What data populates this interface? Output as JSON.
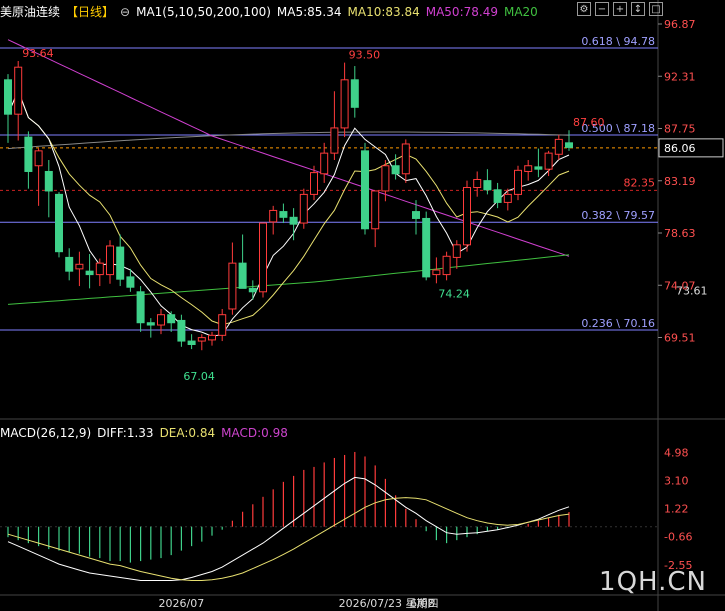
{
  "header": {
    "instrument": "美原油连续",
    "period": "【日线】",
    "ma_title": "MA1(5,10,50,200,100)",
    "ma5": "MA5:85.34",
    "ma10": "MA10:83.84",
    "ma50": "MA50:78.49",
    "ma20": "MA20",
    "icons": [
      "settings-icon",
      "minus-icon",
      "plus-icon",
      "tool-icon",
      "maximize-icon"
    ]
  },
  "macd_header": {
    "title": "MACD(26,12,9)",
    "diff": "DIFF:1.33",
    "dea": "DEA:0.84",
    "macd": "MACD:0.98"
  },
  "colors": {
    "up": "#ff3b3b",
    "down": "#3fd18a",
    "ma5": "#ffffff",
    "ma10": "#e8e070",
    "ma50": "#d040d0",
    "ma20": "#40c040",
    "ma200": "#888888",
    "fib": "#8080ff",
    "last": "#ff9900",
    "macd_label": "#cc44cc"
  },
  "chart_data": {
    "type": "candlestick",
    "title": "美原油连续",
    "price_ylim": [
      66.5,
      96.87
    ],
    "price_ticks": [
      "96.87",
      "92.31",
      "87.75",
      "83.19",
      "78.63",
      "74.07",
      "69.51"
    ],
    "current_price": "86.06",
    "secondary_price": "73.61",
    "fib_levels": [
      {
        "label": "0.618 \\ 94.78",
        "value": 94.78
      },
      {
        "label": "0.500 \\ 87.18",
        "value": 87.18
      },
      {
        "label": "0.382 \\ 79.57",
        "value": 79.57
      },
      {
        "label": "0.236 \\ 70.16",
        "value": 70.16
      }
    ],
    "red_level": {
      "label": "82.35",
      "value": 82.35
    },
    "annotations": [
      {
        "text": "93.64",
        "index": 1,
        "value": 93.64,
        "color": "red"
      },
      {
        "text": "93.50",
        "index": 33,
        "value": 93.5,
        "color": "red"
      },
      {
        "text": "67.04",
        "index": 17,
        "value": 67.04,
        "color": "green"
      },
      {
        "text": "74.24",
        "index": 42,
        "value": 74.24,
        "color": "green"
      },
      {
        "text": "87.60",
        "index": 55,
        "value": 87.6,
        "color": "red"
      }
    ],
    "candles": [
      [
        92,
        92.5,
        86.5,
        89
      ],
      [
        89,
        93.64,
        86.7,
        93.1
      ],
      [
        87,
        87.5,
        82.5,
        84
      ],
      [
        84.5,
        86,
        81,
        85.8
      ],
      [
        84,
        85,
        80,
        82.3
      ],
      [
        82,
        82.2,
        76.5,
        77
      ],
      [
        76.5,
        77.3,
        74.5,
        75.3
      ],
      [
        75.5,
        77,
        74,
        75.9
      ],
      [
        75.3,
        76.8,
        73.8,
        75
      ],
      [
        75,
        76.4,
        74,
        76
      ],
      [
        75,
        78,
        74.2,
        77.5
      ],
      [
        77.4,
        78.5,
        74,
        74.6
      ],
      [
        74.8,
        75.5,
        73.5,
        73.9
      ],
      [
        73.5,
        74,
        70,
        70.8
      ],
      [
        70.8,
        71.2,
        69.5,
        70.6
      ],
      [
        70.6,
        72,
        69.8,
        71.5
      ],
      [
        71.5,
        71.8,
        70,
        70.8
      ],
      [
        71,
        71.5,
        68.7,
        69.2
      ],
      [
        69.2,
        69.8,
        68.5,
        68.9
      ],
      [
        69.2,
        69.8,
        68.4,
        69.5
      ],
      [
        69.3,
        70,
        68.8,
        69.7
      ],
      [
        69.7,
        72,
        69.2,
        71.5
      ],
      [
        72,
        77.8,
        71.5,
        76
      ],
      [
        76,
        78.5,
        75,
        73.8
      ],
      [
        73.8,
        74.5,
        72.8,
        73.5
      ],
      [
        73.5,
        78,
        73,
        79.5
      ],
      [
        79.6,
        81,
        78.5,
        80.6
      ],
      [
        80.5,
        81.2,
        79.5,
        80
      ],
      [
        80,
        80.8,
        78,
        79.4
      ],
      [
        79.5,
        82.5,
        79,
        82
      ],
      [
        82,
        84.5,
        81.5,
        83.9
      ],
      [
        83.8,
        86.5,
        83,
        85.6
      ],
      [
        85.6,
        91,
        85,
        87.8
      ],
      [
        87.8,
        93.5,
        87,
        92
      ],
      [
        92,
        93.2,
        88.7,
        89.6
      ],
      [
        85.8,
        86.5,
        78.5,
        79
      ],
      [
        79,
        82,
        77.4,
        82.3
      ],
      [
        82.3,
        85,
        81.4,
        84.5
      ],
      [
        84.5,
        85.5,
        83.3,
        83.8
      ],
      [
        83.8,
        86.8,
        83,
        86.4
      ],
      [
        80.5,
        81.5,
        78.5,
        79.9
      ],
      [
        79.9,
        80.5,
        74.5,
        74.8
      ],
      [
        75,
        76.5,
        74.24,
        75.4
      ],
      [
        75,
        77,
        74.5,
        76.6
      ],
      [
        76.5,
        78,
        75.5,
        77.6
      ],
      [
        77.6,
        83.2,
        77,
        82.6
      ],
      [
        82.6,
        84,
        81.8,
        83.3
      ],
      [
        83.2,
        84.2,
        82,
        82.4
      ],
      [
        82.4,
        83,
        80.8,
        81.3
      ],
      [
        81.3,
        82.5,
        80.6,
        82
      ],
      [
        82,
        84.5,
        81.5,
        84.1
      ],
      [
        84,
        85,
        83.2,
        84.5
      ],
      [
        84.4,
        86,
        83.5,
        84.2
      ],
      [
        84.2,
        85.8,
        83.6,
        85.6
      ],
      [
        85.5,
        87.2,
        85,
        86.8
      ],
      [
        86.5,
        87.6,
        85.8,
        86.1
      ]
    ],
    "macd_ylim": [
      -3.9,
      5.6
    ],
    "macd_ticks": [
      "4.98",
      "3.10",
      "1.22",
      "-0.66",
      "-2.55"
    ],
    "macd_hist": [
      -0.7,
      -0.9,
      -1.1,
      -1.3,
      -1.5,
      -1.6,
      -1.7,
      -1.8,
      -2,
      -2.1,
      -2.3,
      -2.3,
      -2.4,
      -2.3,
      -2.2,
      -2.1,
      -1.9,
      -1.6,
      -1.3,
      -1,
      -0.6,
      -0.2,
      0.4,
      1,
      1.5,
      2,
      2.5,
      3,
      3.4,
      3.8,
      4,
      4.3,
      4.6,
      4.8,
      5,
      4.7,
      4.1,
      3.2,
      2.1,
      1.2,
      0.5,
      -0.3,
      -0.9,
      -1.1,
      -0.9,
      -0.7,
      -0.5,
      -0.3,
      -0.2,
      -0.1,
      0,
      0.2,
      0.4,
      0.6,
      0.8,
      0.98
    ],
    "macd_diff": [
      -1,
      -1.3,
      -1.6,
      -1.9,
      -2.2,
      -2.5,
      -2.7,
      -2.9,
      -3.1,
      -3.2,
      -3.3,
      -3.4,
      -3.5,
      -3.6,
      -3.6,
      -3.6,
      -3.6,
      -3.55,
      -3.4,
      -3.2,
      -3,
      -2.7,
      -2.3,
      -1.9,
      -1.5,
      -1.1,
      -0.6,
      -0.1,
      0.4,
      0.9,
      1.4,
      1.9,
      2.4,
      2.9,
      3.3,
      3.2,
      2.8,
      2.3,
      1.8,
      1.3,
      0.9,
      0.4,
      0,
      -0.4,
      -0.5,
      -0.45,
      -0.4,
      -0.3,
      -0.2,
      -0.05,
      0.1,
      0.3,
      0.5,
      0.8,
      1.1,
      1.33
    ],
    "macd_dea": [
      -0.5,
      -0.7,
      -0.9,
      -1.1,
      -1.3,
      -1.5,
      -1.7,
      -1.9,
      -2.1,
      -2.3,
      -2.5,
      -2.6,
      -2.8,
      -3,
      -3.15,
      -3.3,
      -3.45,
      -3.55,
      -3.6,
      -3.6,
      -3.55,
      -3.45,
      -3.3,
      -3.1,
      -2.8,
      -2.5,
      -2.2,
      -1.85,
      -1.5,
      -1.1,
      -0.7,
      -0.3,
      0.1,
      0.5,
      0.9,
      1.3,
      1.6,
      1.8,
      1.9,
      1.95,
      1.9,
      1.8,
      1.5,
      1.2,
      0.9,
      0.6,
      0.4,
      0.25,
      0.15,
      0.1,
      0.15,
      0.3,
      0.45,
      0.6,
      0.75,
      0.84
    ],
    "date_labels": [
      {
        "text": "2026/07",
        "index": 17
      },
      {
        "text": "2026/07/23 星期四",
        "index": 33
      },
      {
        "text": "6/08",
        "index": 40
      }
    ]
  },
  "watermark": "1QH.CN"
}
